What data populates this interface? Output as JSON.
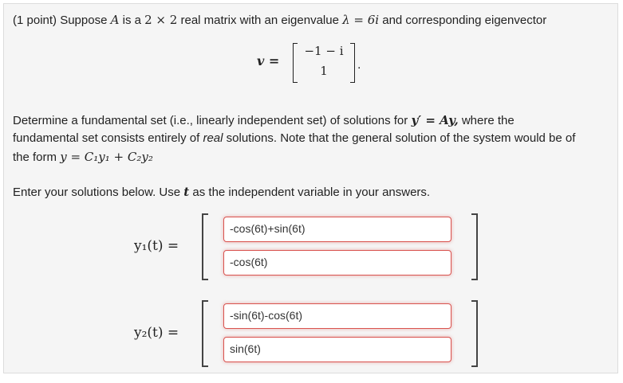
{
  "problem": {
    "points": "(1 point)",
    "intro": "Suppose",
    "matrix_var": "A",
    "is_a": "is a",
    "size": "2 × 2",
    "real_matrix_text": "real matrix with an eigenvalue",
    "eigenvalue": "λ = 6i",
    "corresponding": "and corresponding eigenvector",
    "eigvec_label": "v =",
    "eigvec_top": "−1 − i",
    "eigvec_bottom": "1",
    "determine_line1_a": "Determine a fundamental set (i.e., linearly independent set) of solutions for",
    "ode": "y′ = Ay,",
    "determine_line1_b": "where the",
    "determine_line2_a": "fundamental set consists entirely of",
    "real_word": "real",
    "determine_line2_b": "solutions. Note that the general solution of the system would be of",
    "determine_line3_a": "the form",
    "general_solution": "y = C₁y₁ + C₂y₂",
    "enter_a": "Enter your solutions below. Use",
    "t_var": "t",
    "enter_b": "as the independent variable in your answers."
  },
  "answers": {
    "y1_label": "y₁(t) =",
    "y1_top": "-cos(6t)+sin(6t)",
    "y1_bottom": "-cos(6t)",
    "y2_label": "y₂(t) =",
    "y2_top": "-sin(6t)-cos(6t)",
    "y2_bottom": "sin(6t)"
  },
  "colors": {
    "input_border": "#d9534f",
    "card_background": "#f5f5f5"
  }
}
